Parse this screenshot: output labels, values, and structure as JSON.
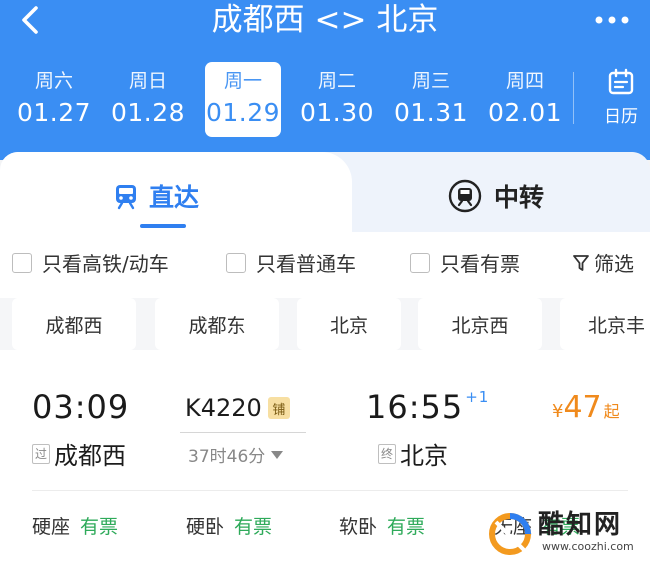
{
  "header": {
    "title": "成都西 <> 北京",
    "back_icon": "chevron-left-icon",
    "more_icon": "more-dots-icon"
  },
  "dates": [
    {
      "weekday": "周六",
      "date": "01.27",
      "active": false
    },
    {
      "weekday": "周日",
      "date": "01.28",
      "active": false
    },
    {
      "weekday": "周一",
      "date": "01.29",
      "active": true
    },
    {
      "weekday": "周二",
      "date": "01.30",
      "active": false
    },
    {
      "weekday": "周三",
      "date": "01.31",
      "active": false
    },
    {
      "weekday": "周四",
      "date": "02.01",
      "active": false
    }
  ],
  "calendar": {
    "label": "日历",
    "icon": "calendar-icon"
  },
  "tabs": [
    {
      "label": "直达",
      "icon": "train-icon",
      "active": true
    },
    {
      "label": "中转",
      "icon": "transfer-icon",
      "active": false
    }
  ],
  "filters": [
    {
      "label": "只看高铁/动车"
    },
    {
      "label": "只看普通车"
    },
    {
      "label": "只看有票"
    },
    {
      "label": "筛选",
      "icon": "filter-icon"
    }
  ],
  "stations": [
    "成都西",
    "成都东",
    "北京",
    "北京西",
    "北京丰"
  ],
  "train": {
    "dep_time": "03:09",
    "dep_tag": "过",
    "dep_station": "成都西",
    "number": "K4220",
    "badge": "铺",
    "duration": "37时46分",
    "arr_time": "16:55",
    "day_offset": "+1",
    "arr_tag": "终",
    "arr_station": "北京",
    "price_currency": "¥",
    "price_value": "47",
    "price_unit": "起",
    "seats": [
      {
        "type": "硬座",
        "status": "有票"
      },
      {
        "type": "硬卧",
        "status": "有票"
      },
      {
        "type": "软卧",
        "status": "有票"
      },
      {
        "type": "无座",
        "status": "有票"
      }
    ]
  },
  "watermark": {
    "text": "酷知网",
    "url": "www.coozhi.com"
  },
  "colors": {
    "primary": "#3a8ef3",
    "accent_price": "#f08a1c",
    "available": "#2eaa5a"
  }
}
